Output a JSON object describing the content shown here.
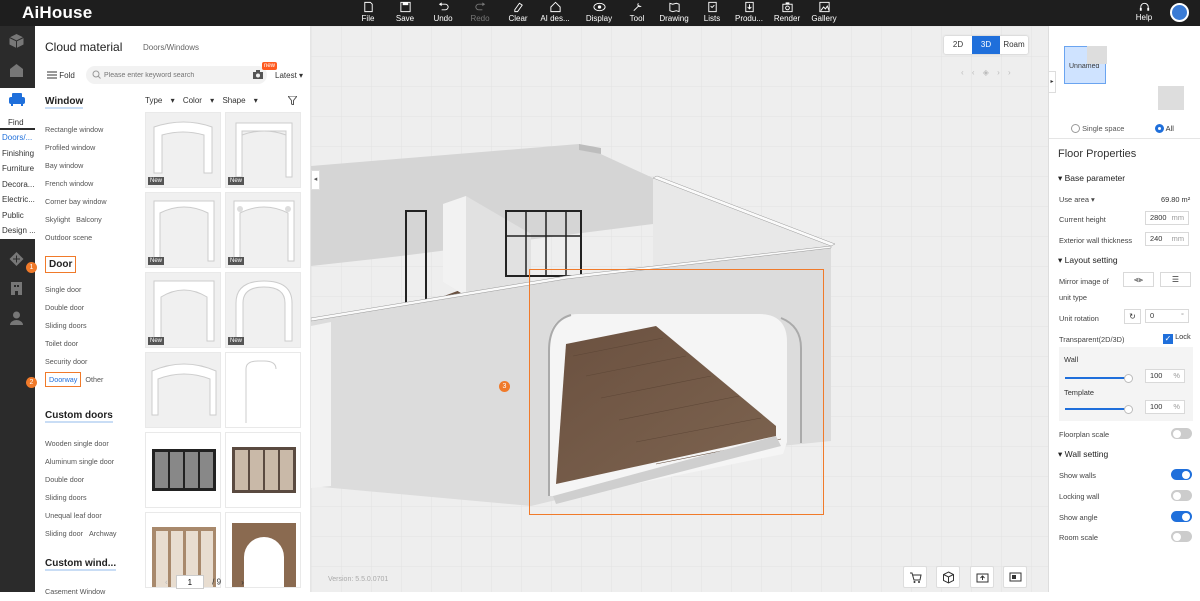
{
  "app": {
    "logo": "AiHouse"
  },
  "toolbar": [
    {
      "label": "File",
      "icon": "file-icon"
    },
    {
      "label": "Save",
      "icon": "save-icon"
    },
    {
      "label": "Undo",
      "icon": "undo-icon"
    },
    {
      "label": "Redo",
      "icon": "redo-icon"
    },
    {
      "label": "Clear",
      "icon": "clear-icon"
    },
    {
      "label": "AI des...",
      "icon": "ai-design-icon"
    },
    {
      "label": "Display",
      "icon": "display-icon"
    },
    {
      "label": "Tool",
      "icon": "tool-icon"
    },
    {
      "label": "Drawing",
      "icon": "drawing-icon"
    },
    {
      "label": "Lists",
      "icon": "lists-icon"
    },
    {
      "label": "Produ...",
      "icon": "product-icon"
    },
    {
      "label": "Render",
      "icon": "render-icon"
    },
    {
      "label": "Gallery",
      "icon": "gallery-icon"
    }
  ],
  "help": {
    "label": "Help"
  },
  "nav": {
    "find": "Find",
    "items": [
      "Doors/...",
      "Finishing",
      "Furniture",
      "Decora...",
      "Electric...",
      "Public",
      "Design ..."
    ]
  },
  "panel": {
    "title": "Cloud material",
    "subtitle": "Doors/Windows",
    "fold": "Fold",
    "search_placeholder": "Please enter keyword search",
    "new_badge": "new",
    "sort": "Latest",
    "filters": [
      "Type",
      "Color",
      "Shape"
    ],
    "categories": [
      {
        "title": "Window",
        "items": [
          "Rectangle window",
          "Profiled window",
          "Bay window",
          "French window",
          "Corner bay window",
          "Skylight",
          "Balcony",
          "Outdoor scene"
        ]
      },
      {
        "title": "Door",
        "items": [
          "Single door",
          "Double door",
          "Sliding doors",
          "Toilet door",
          "Security door",
          "Doorway",
          "Other"
        ]
      },
      {
        "title": "Custom doors",
        "items": [
          "Wooden single door",
          "Aluminum single door",
          "Double door",
          "Sliding doors",
          "Unequal leaf door",
          "Sliding door",
          "Archway"
        ]
      },
      {
        "title": "Custom wind...",
        "items": [
          "Casement Window"
        ]
      }
    ],
    "step_markers": [
      "1",
      "2",
      "3"
    ],
    "card_tag": "New",
    "pager": {
      "current": "1",
      "total": "/ 9"
    }
  },
  "viewport": {
    "view_tabs": [
      "2D",
      "3D",
      "Roam"
    ],
    "active_tab": "3D",
    "version": "Version: 5.5.0.0701"
  },
  "right": {
    "minimap": {
      "room_label": "Unnamed",
      "option_single": "Single space",
      "option_all": "All"
    },
    "title": "Floor Properties",
    "base_parameter": "Base parameter",
    "use_area_label": "Use area",
    "use_area_value": "69.80 m²",
    "current_height_label": "Current height",
    "current_height_value": "2800",
    "ext_wall_label": "Exterior wall thickness",
    "ext_wall_value": "240",
    "unit_mm": "mm",
    "layout_setting": "Layout setting",
    "mirror_label": "Mirror image of",
    "unit_type_label": "unit type",
    "unit_rotation_label": "Unit rotation",
    "unit_rotation_value": "0",
    "unit_deg": "°",
    "transparent_label": "Transparent(2D/3D)",
    "lock_label": "Lock",
    "wall_label": "Wall",
    "wall_value": "100",
    "template_label": "Template",
    "template_value": "100",
    "unit_pct": "%",
    "floorplan_scale": "Floorplan scale",
    "wall_setting": "Wall setting",
    "show_walls": "Show walls",
    "locking_wall": "Locking wall",
    "show_angle": "Show angle",
    "room_scale": "Room scale",
    "toggles": {
      "floorplan_scale": false,
      "show_walls": true,
      "locking_wall": false,
      "show_angle": true,
      "room_scale": false
    }
  },
  "colors": {
    "accent": "#1f6fdb",
    "highlight": "#f07a2a",
    "topbar": "#1e1e1e"
  }
}
